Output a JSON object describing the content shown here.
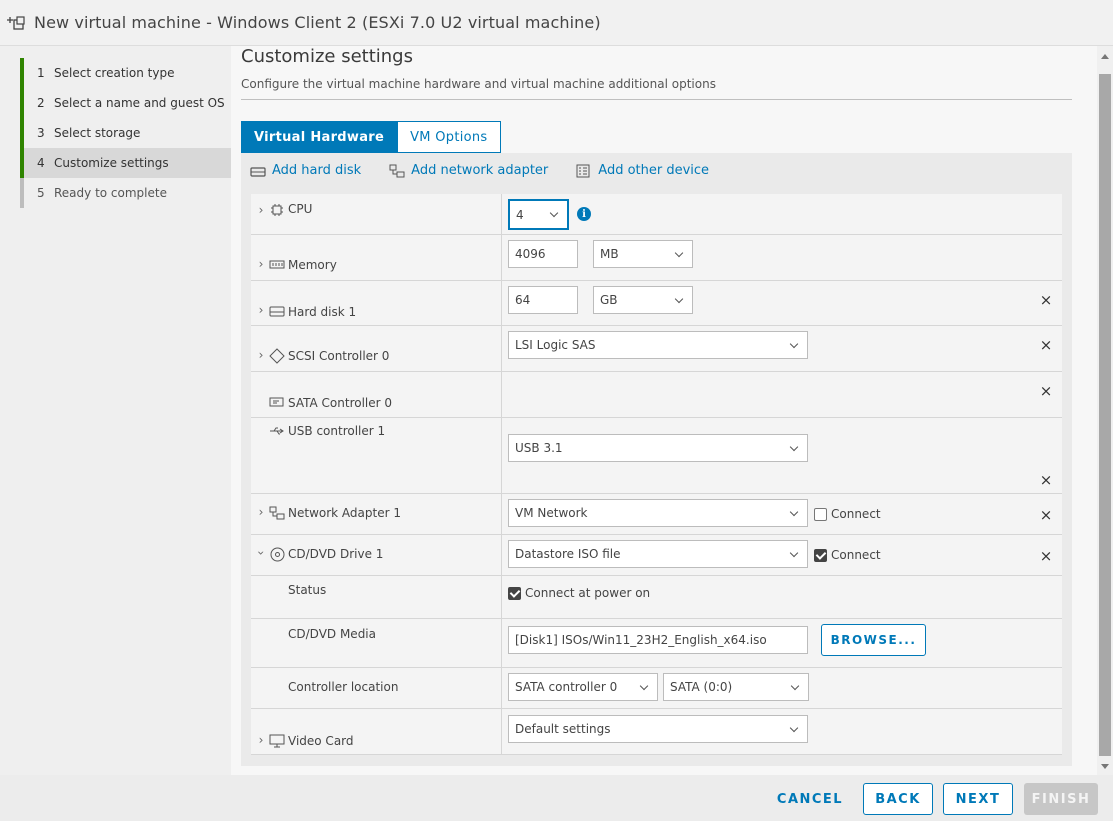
{
  "window": {
    "title": "New virtual machine - Windows Client 2 (ESXi 7.0 U2 virtual machine)"
  },
  "steps": [
    {
      "num": "1",
      "label": "Select creation type",
      "state": "done"
    },
    {
      "num": "2",
      "label": "Select a name and guest OS",
      "state": "done"
    },
    {
      "num": "3",
      "label": "Select storage",
      "state": "done"
    },
    {
      "num": "4",
      "label": "Customize settings",
      "state": "current"
    },
    {
      "num": "5",
      "label": "Ready to complete",
      "state": "pending"
    }
  ],
  "main": {
    "title": "Customize settings",
    "subtitle": "Configure the virtual machine hardware and virtual machine additional options",
    "tabs": [
      {
        "label": "Virtual Hardware",
        "active": true
      },
      {
        "label": "VM Options",
        "active": false
      }
    ],
    "toolbar": {
      "add_hard_disk": "Add hard disk",
      "add_network_adapter": "Add network adapter",
      "add_other_device": "Add other device"
    }
  },
  "hardware": {
    "cpu": {
      "label": "CPU",
      "value": "4"
    },
    "memory": {
      "label": "Memory",
      "value": "4096",
      "unit": "MB"
    },
    "hard_disk": {
      "label": "Hard disk 1",
      "value": "64",
      "unit": "GB"
    },
    "scsi": {
      "label": "SCSI Controller 0",
      "value": "LSI Logic SAS"
    },
    "sata": {
      "label": "SATA Controller 0"
    },
    "usb": {
      "label": "USB controller 1",
      "value": "USB 3.1"
    },
    "network": {
      "label": "Network Adapter 1",
      "value": "VM Network",
      "connect_label": "Connect",
      "connected": false
    },
    "cdrom": {
      "label": "CD/DVD Drive 1",
      "value": "Datastore ISO file",
      "connect_label": "Connect",
      "connected": true,
      "status_label": "Status",
      "status_check_label": "Connect at power on",
      "power_on": true,
      "media_label": "CD/DVD Media",
      "media_value": "[Disk1] ISOs/Win11_23H2_English_x64.iso",
      "browse_label": "BROWSE...",
      "controller_location_label": "Controller location",
      "controller": "SATA controller 0",
      "slot": "SATA (0:0)"
    },
    "video": {
      "label": "Video Card",
      "value": "Default settings"
    }
  },
  "footer": {
    "cancel": "CANCEL",
    "back": "BACK",
    "next": "NEXT",
    "finish": "FINISH"
  },
  "colors": {
    "accent": "#0079b8",
    "done_step": "#2f8400",
    "disabled": "#c7c7c7"
  }
}
